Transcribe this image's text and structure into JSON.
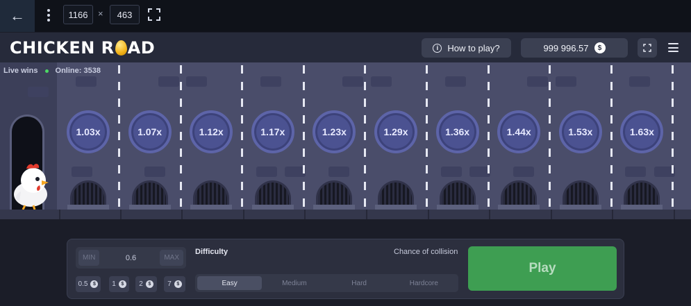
{
  "devtools": {
    "back_icon": "←",
    "width_value": "1166",
    "times": "×",
    "height_value": "463"
  },
  "header": {
    "logo_part1": "CHICKEN R",
    "logo_part2": "AD",
    "how_to_play": "How to play?",
    "balance": "999 996.57",
    "currency_symbol": "$"
  },
  "scene": {
    "live_wins": "Live wins",
    "online": "Online: 3538",
    "lanes": [
      {
        "multiplier": "1.03x"
      },
      {
        "multiplier": "1.07x"
      },
      {
        "multiplier": "1.12x"
      },
      {
        "multiplier": "1.17x"
      },
      {
        "multiplier": "1.23x"
      },
      {
        "multiplier": "1.29x"
      },
      {
        "multiplier": "1.36x"
      },
      {
        "multiplier": "1.44x"
      },
      {
        "multiplier": "1.53x"
      },
      {
        "multiplier": "1.63x"
      }
    ]
  },
  "controls": {
    "min_label": "MIN",
    "max_label": "MAX",
    "bet_value": "0.6",
    "quick_bets": [
      "0.5",
      "1",
      "2",
      "7"
    ],
    "difficulty_label": "Difficulty",
    "collision_label": "Chance of collision",
    "difficulty_options": [
      "Easy",
      "Medium",
      "Hard",
      "Hardcore"
    ],
    "selected_difficulty": "Easy",
    "play_label": "Play"
  },
  "colors": {
    "play_button": "#3e9e52",
    "online_dot": "#4cd964",
    "multiplier": "#4b5291"
  }
}
